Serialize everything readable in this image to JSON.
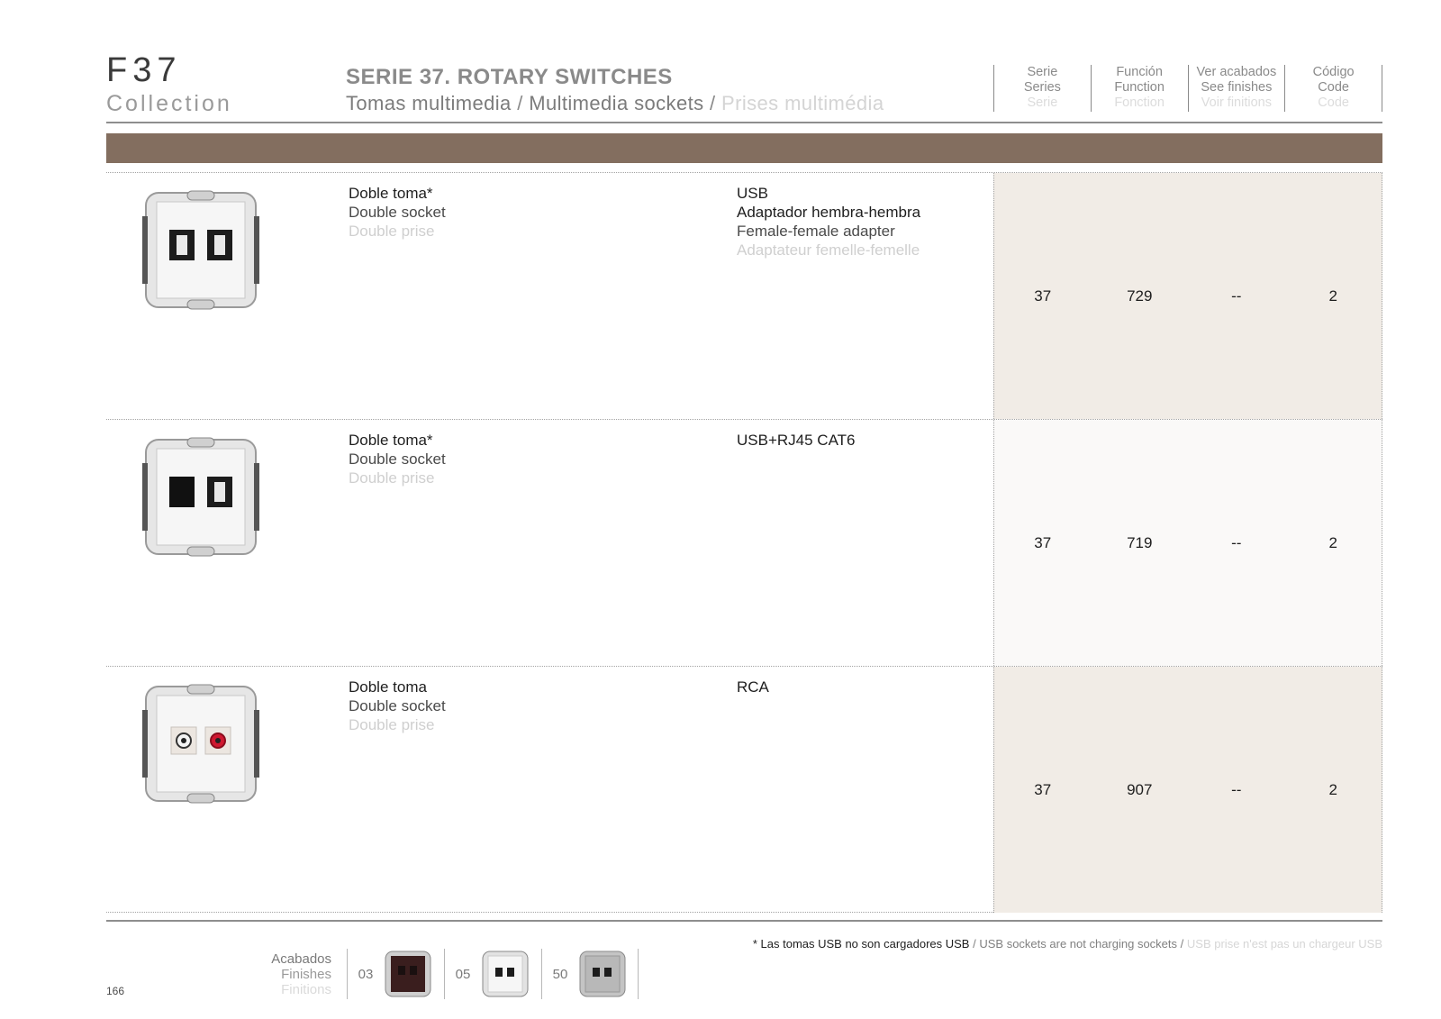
{
  "header": {
    "brand_code": "F37",
    "brand_sub": "Collection",
    "series_title": "SERIE 37. ROTARY SWITCHES",
    "subtitle_es": "Tomas multimedia",
    "subtitle_en": "Multimedia sockets",
    "subtitle_fr": "Prises multimédia",
    "separator": "/"
  },
  "columns": [
    {
      "es": "Serie",
      "en": "Series",
      "fr": "Serie"
    },
    {
      "es": "Función",
      "en": "Function",
      "fr": "Fonction"
    },
    {
      "es": "Ver acabados",
      "en": "See finishes",
      "fr": "Voir finitions"
    },
    {
      "es": "Código",
      "en": "Code",
      "fr": "Code"
    }
  ],
  "colors": {
    "band": "#836e5f",
    "row_shade": "#f1ece6",
    "row_light": "#faf9f8"
  },
  "rows": [
    {
      "image": "usb-double-socket-icon",
      "desc": [
        "Doble toma*",
        "Double socket",
        "Double prise"
      ],
      "func": [
        "USB",
        "Adaptador  hembra-hembra",
        "Female-female adapter",
        "Adaptateur femelle-femelle"
      ],
      "serie": "37",
      "function": "729",
      "finishes": "--",
      "code": "2"
    },
    {
      "image": "usb-rj45-double-socket-icon",
      "desc": [
        "Doble toma*",
        "Double socket",
        "Double prise"
      ],
      "func": [
        "USB+RJ45 CAT6"
      ],
      "serie": "37",
      "function": "719",
      "finishes": "--",
      "code": "2"
    },
    {
      "image": "rca-double-socket-icon",
      "desc": [
        "Doble toma",
        "Double socket",
        "Double prise"
      ],
      "func": [
        "RCA"
      ],
      "serie": "37",
      "function": "907",
      "finishes": "--",
      "code": "2"
    }
  ],
  "footnote": {
    "es": "* Las tomas USB no son cargadores USB",
    "en": "USB sockets are not charging sockets",
    "fr": "USB prise n'est pas un chargeur USB",
    "separator": "/"
  },
  "finishes": {
    "label_es": "Acabados",
    "label_en": "Finishes",
    "label_fr": "Finitions",
    "items": [
      {
        "num": "03",
        "color": "#3a1e1e",
        "icon": "finish-dark-thumb-icon"
      },
      {
        "num": "05",
        "color": "#f2f2f2",
        "icon": "finish-white-thumb-icon"
      },
      {
        "num": "50",
        "color": "#b8b8b8",
        "icon": "finish-silver-thumb-icon"
      }
    ]
  },
  "page_number": "166"
}
